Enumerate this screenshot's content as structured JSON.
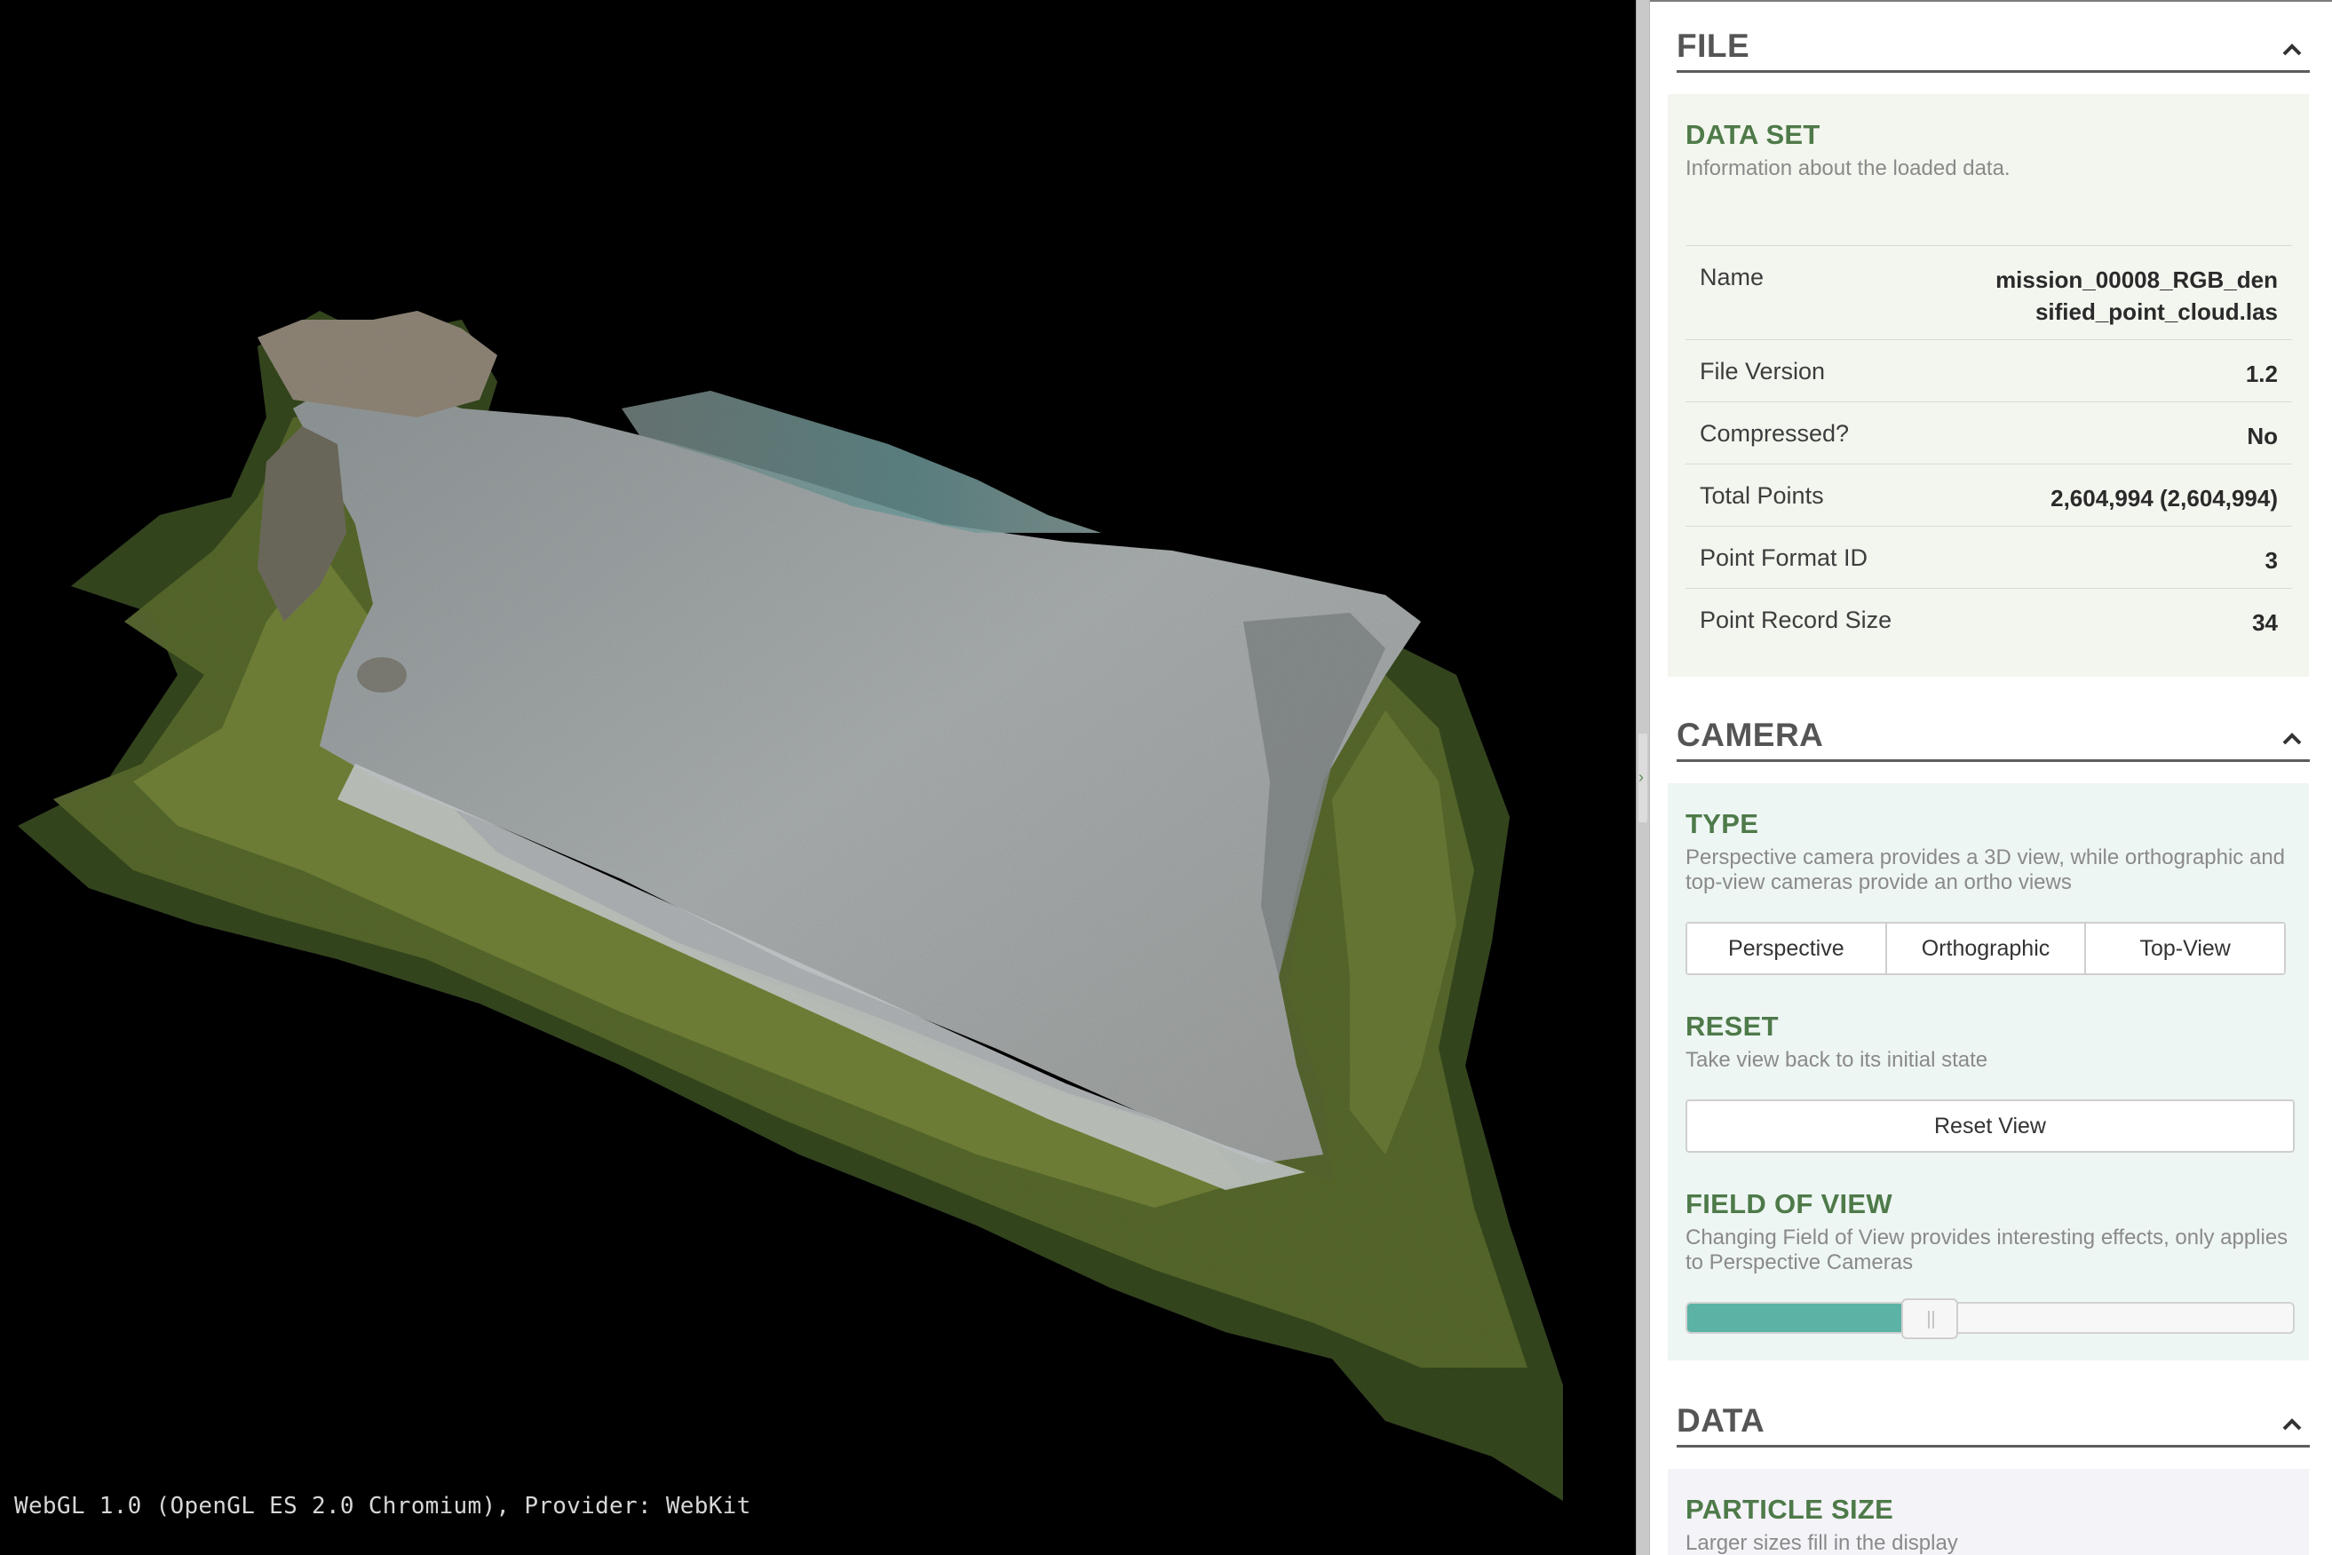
{
  "viewport": {
    "webgl_info": "WebGL 1.0 (OpenGL ES 2.0 Chromium), Provider: WebKit"
  },
  "splitter": {
    "arrow_icon": "chevron-right-icon",
    "arrow_glyph": "›"
  },
  "file_section": {
    "title": "FILE",
    "collapse_icon": "chevron-up-icon",
    "dataset": {
      "title": "DATA SET",
      "description": "Information about the loaded data.",
      "rows": [
        {
          "key": "Name",
          "value": "mission_00008_RGB_densified_point_cloud.las"
        },
        {
          "key": "File Version",
          "value": "1.2"
        },
        {
          "key": "Compressed?",
          "value": "No"
        },
        {
          "key": "Total Points",
          "value": "2,604,994 (2,604,994)"
        },
        {
          "key": "Point Format ID",
          "value": "3"
        },
        {
          "key": "Point Record Size",
          "value": "34"
        }
      ]
    }
  },
  "camera_section": {
    "title": "CAMERA",
    "collapse_icon": "chevron-up-icon",
    "type": {
      "title": "TYPE",
      "description": "Perspective camera provides a 3D view, while orthographic and top-view cameras provide an ortho views",
      "options": [
        "Perspective",
        "Orthographic",
        "Top-View"
      ]
    },
    "reset": {
      "title": "RESET",
      "description": "Take view back to its initial state",
      "button_label": "Reset View"
    },
    "fov": {
      "title": "FIELD OF VIEW",
      "description": "Changing Field of View provides interesting effects, only applies to Perspective Cameras",
      "value_fraction": 0.4
    }
  },
  "data_section": {
    "title": "DATA",
    "collapse_icon": "chevron-up-icon",
    "particle_size": {
      "title": "PARTICLE SIZE",
      "description": "Larger sizes fill in the display"
    }
  },
  "colors": {
    "accent_green": "#4e7a49",
    "slider_fill": "#5cb3a5",
    "viewport_bg": "#000000"
  }
}
